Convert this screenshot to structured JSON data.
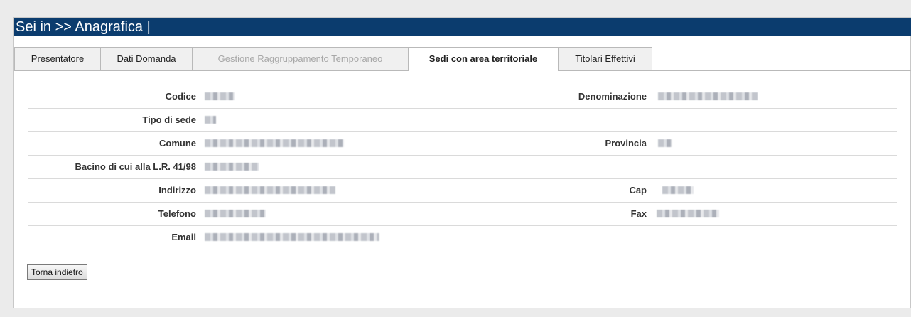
{
  "header": {
    "title": "Sei in >> Anagrafica |"
  },
  "tabs": [
    {
      "label": "Presentatore",
      "state": "normal"
    },
    {
      "label": "Dati Domanda",
      "state": "normal"
    },
    {
      "label": "Gestione Raggruppamento Temporaneo",
      "state": "disabled"
    },
    {
      "label": "Sedi con area territoriale",
      "state": "active"
    },
    {
      "label": "Titolari Effettivi",
      "state": "normal"
    }
  ],
  "fields": {
    "codice": {
      "label": "Codice",
      "value": ""
    },
    "denominazione": {
      "label": "Denominazione",
      "value": ""
    },
    "tipo_sede": {
      "label": "Tipo di sede",
      "value": ""
    },
    "comune": {
      "label": "Comune",
      "value": ""
    },
    "provincia": {
      "label": "Provincia",
      "value": ""
    },
    "bacino": {
      "label": "Bacino di cui alla L.R. 41/98",
      "value": ""
    },
    "indirizzo": {
      "label": "Indirizzo",
      "value": ""
    },
    "cap": {
      "label": "Cap",
      "value": ""
    },
    "telefono": {
      "label": "Telefono",
      "value": ""
    },
    "fax": {
      "label": "Fax",
      "value": ""
    },
    "email": {
      "label": "Email",
      "value": ""
    }
  },
  "actions": {
    "back_label": "Torna indietro"
  },
  "colors": {
    "title_bar": "#0b3c6e",
    "background": "#ebebeb"
  }
}
